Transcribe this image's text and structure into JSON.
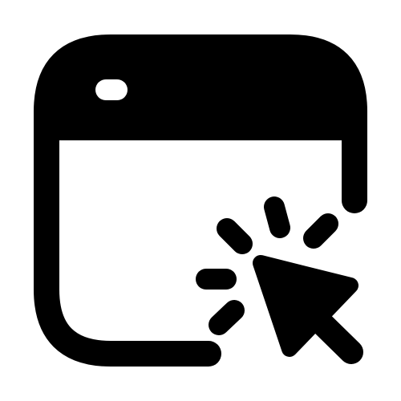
{
  "icon": {
    "name": "browser-window-click-icon",
    "components": [
      "browser-window-icon",
      "mouse-pointer-icon",
      "click-burst-icon"
    ],
    "color": "#000000",
    "background": "#ffffff"
  }
}
